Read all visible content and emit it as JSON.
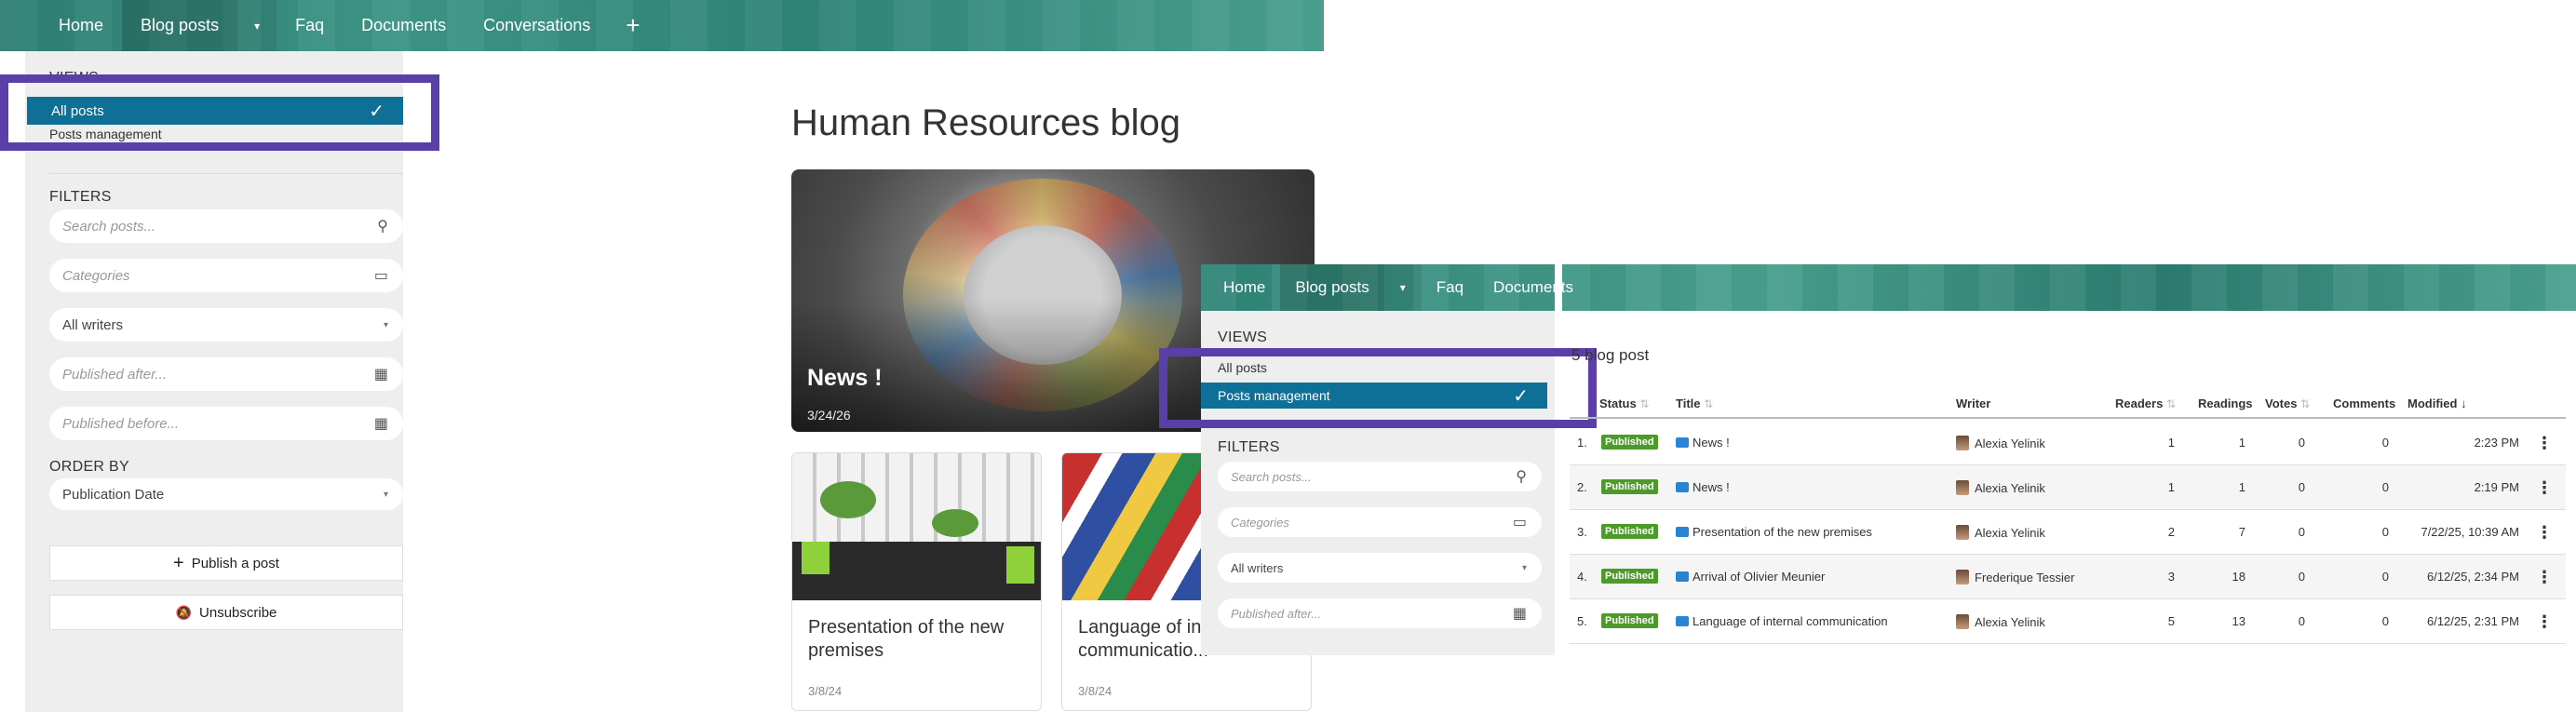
{
  "nav": {
    "items": [
      "Home",
      "Blog posts",
      "Faq",
      "Documents",
      "Conversations"
    ],
    "plus": "+",
    "caret": "▾"
  },
  "sidebar": {
    "views_label": "VIEWS",
    "views": [
      "All posts",
      "Posts management"
    ],
    "filters_label": "FILTERS",
    "search_placeholder": "Search posts...",
    "categories_placeholder": "Categories",
    "writers_value": "All writers",
    "published_after_placeholder": "Published after...",
    "published_before_placeholder": "Published before...",
    "order_label": "ORDER BY",
    "order_value": "Publication Date",
    "publish_button": "Publish a post",
    "unsubscribe_button": "Unsubscribe"
  },
  "blog": {
    "title": "Human Resources blog",
    "featured": {
      "title": "News !",
      "date": "3/24/26"
    },
    "cards": [
      {
        "title": "Presentation of the new premises",
        "date": "3/8/24"
      },
      {
        "title": "Language of internal communicatio...",
        "date": "3/8/24"
      }
    ]
  },
  "overlay": {
    "nav": [
      "Home",
      "Blog posts",
      "Faq",
      "Documents"
    ],
    "views_label": "VIEWS",
    "views": [
      "All posts",
      "Posts management"
    ],
    "filters_label": "FILTERS",
    "search_placeholder": "Search posts...",
    "categories_placeholder": "Categories",
    "writers_value": "All writers",
    "published_after_placeholder": "Published after...",
    "count_label": "5 blog post",
    "columns": {
      "status": "Status",
      "title": "Title",
      "writer": "Writer",
      "readers": "Readers",
      "readings": "Readings",
      "votes": "Votes",
      "comments": "Comments",
      "modified": "Modified"
    },
    "rows": [
      {
        "idx": "1.",
        "status": "Published",
        "title": "News !",
        "writer": "Alexia Yelinik",
        "readers": "1",
        "readings": "1",
        "votes": "0",
        "comments": "0",
        "modified": "2:23 PM"
      },
      {
        "idx": "2.",
        "status": "Published",
        "title": "News !",
        "writer": "Alexia Yelinik",
        "readers": "1",
        "readings": "1",
        "votes": "0",
        "comments": "0",
        "modified": "2:19 PM"
      },
      {
        "idx": "3.",
        "status": "Published",
        "title": "Presentation of the new premises",
        "writer": "Alexia Yelinik",
        "readers": "2",
        "readings": "7",
        "votes": "0",
        "comments": "0",
        "modified": "7/22/25, 10:39 AM"
      },
      {
        "idx": "4.",
        "status": "Published",
        "title": "Arrival of Olivier Meunier",
        "writer": "Frederique Tessier",
        "readers": "3",
        "readings": "18",
        "votes": "0",
        "comments": "0",
        "modified": "6/12/25, 2:34 PM"
      },
      {
        "idx": "5.",
        "status": "Published",
        "title": "Language of internal communication",
        "writer": "Alexia Yelinik",
        "readers": "5",
        "readings": "13",
        "votes": "0",
        "comments": "0",
        "modified": "6/12/25, 2:31 PM"
      }
    ]
  },
  "icons": {
    "check": "✓",
    "search": "⚲",
    "folder": "▭",
    "calendar": "▦",
    "plus": "+",
    "bell_off": "🔕",
    "more": "⋮",
    "sort": "⇅",
    "sort_down": "↓"
  },
  "colors": {
    "accent": "#0e6f97",
    "nav_bg": "#3d9586",
    "highlight": "#5b3fa8",
    "published": "#4c9a2a",
    "sidebar_bg": "#eeeeee"
  }
}
